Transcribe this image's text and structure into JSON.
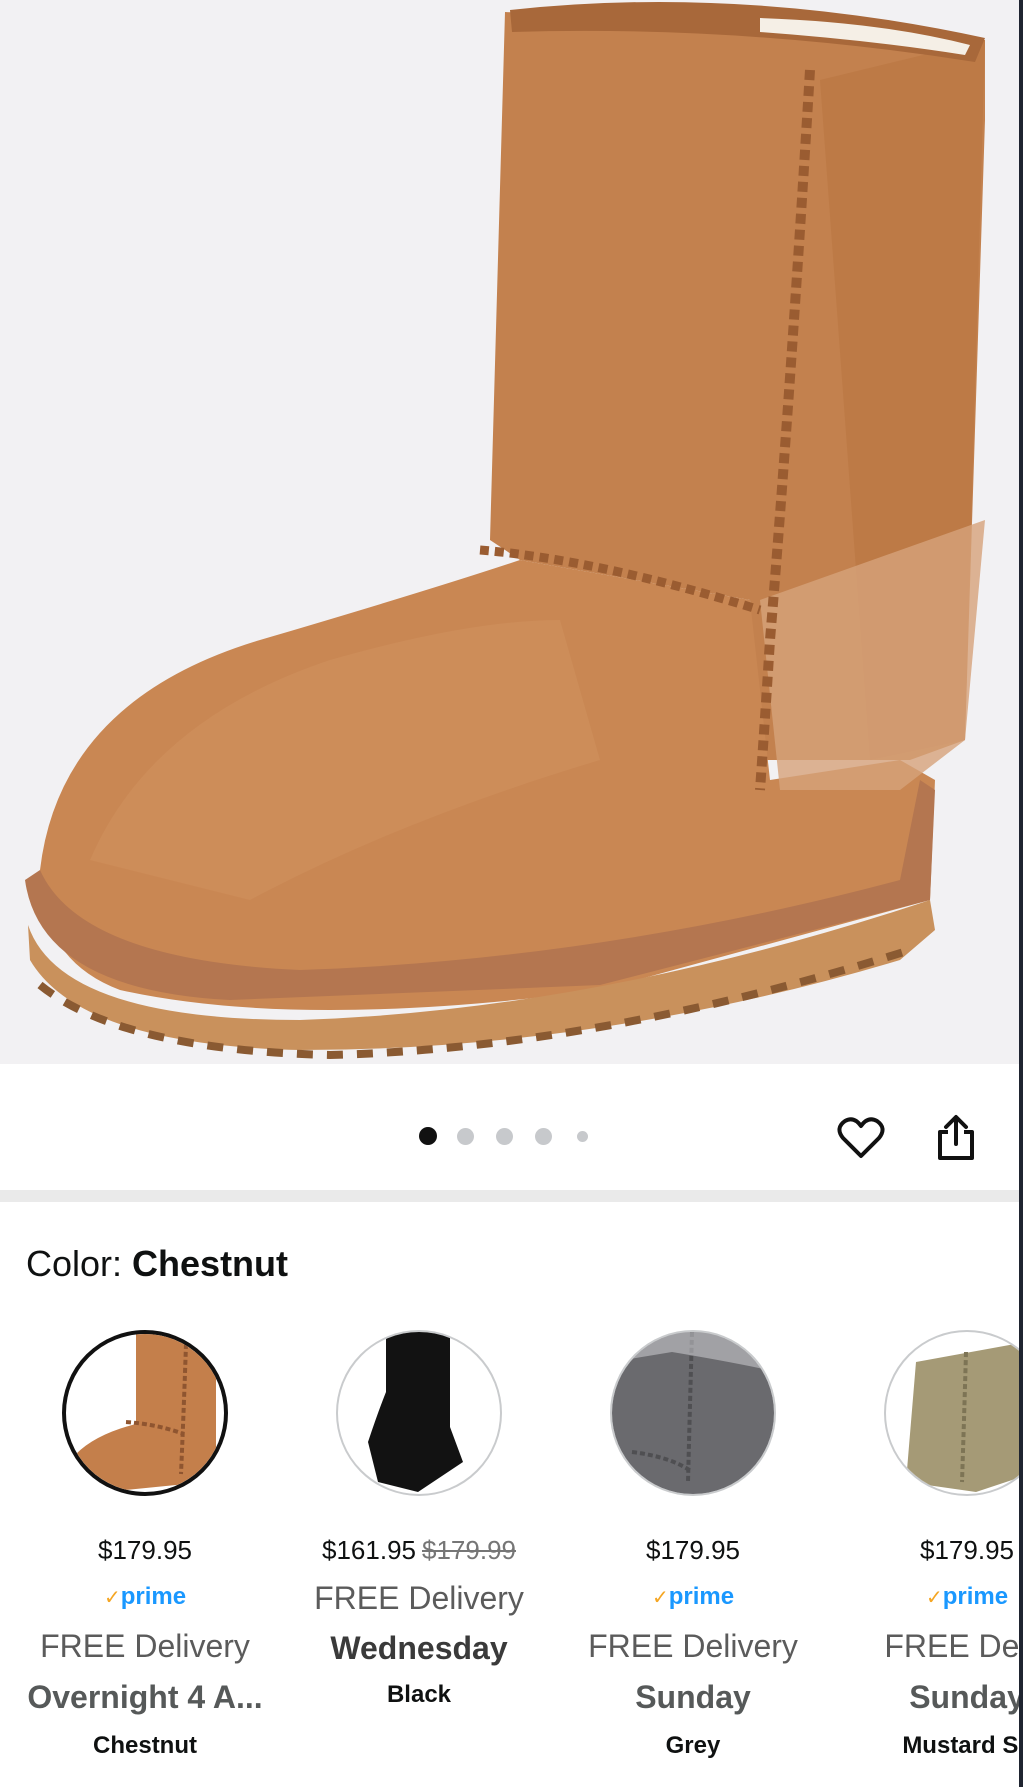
{
  "gallery": {
    "image_alt": "Short suede boot in chestnut color",
    "dots_total": 5,
    "dot_active_index": 0
  },
  "actions": {
    "favorite_icon": "heart-icon",
    "share_icon": "share-icon"
  },
  "color": {
    "label": "Color: ",
    "value": "Chestnut"
  },
  "variants": [
    {
      "price": "$179.95",
      "old_price": "",
      "prime": "prime",
      "delivery_label": "FREE Delivery",
      "delivery_day": "Overnight 4 A...",
      "color_name": "Chestnut",
      "boot_color": "#c47f4b",
      "selected": true
    },
    {
      "price": "$161.95",
      "old_price": "$179.99",
      "prime": "",
      "delivery_label": "FREE Delivery",
      "delivery_day": "Wednesday",
      "color_name": "Black",
      "boot_color": "#121212",
      "selected": false
    },
    {
      "price": "$179.95",
      "old_price": "",
      "prime": "prime",
      "delivery_label": "FREE Delivery",
      "delivery_day": "Sunday",
      "color_name": "Grey",
      "boot_color": "#67676b",
      "selected": false
    },
    {
      "price": "$179.95",
      "old_price": "",
      "prime": "prime",
      "delivery_label": "FREE Deliv",
      "delivery_day": "Sunday",
      "color_name": "Mustard Se",
      "boot_color": "#a59a76",
      "selected": false
    }
  ],
  "colors": {
    "prime_blue": "#1a98ff",
    "prime_check": "#f5a623",
    "chestnut": "#c47f4b"
  }
}
